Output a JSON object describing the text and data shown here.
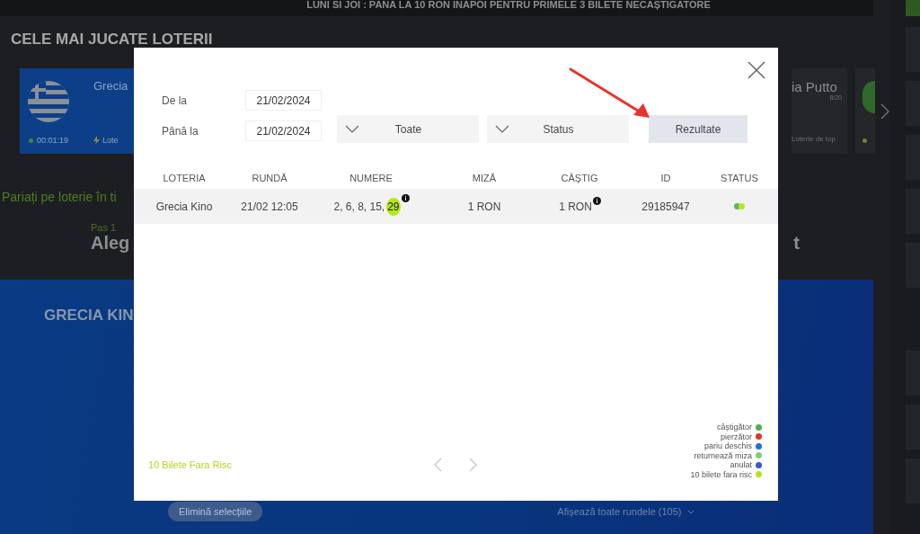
{
  "banner": {
    "text": "LUNI SI JOI : PANA LA 10 RON INAPOI PENTRU PRIMELE 3 BILETE NECAȘTIGATORE"
  },
  "section_title": "CELE MAI JUCATE LOTERII",
  "featured_card": {
    "name": "Grecia",
    "timer": "00:01:19",
    "tag": "Lote"
  },
  "side_card": {
    "name": "ia Putto",
    "count": "8/20",
    "tag": "Loterie de top"
  },
  "promo_text": "Pariați pe loterie în ti",
  "step": {
    "label": "Pas 1",
    "title": "Aleg",
    "title_end": "t"
  },
  "game_panel": {
    "title": "GRECIA KIN",
    "clear_button": "Elimină selecțiile",
    "show_all": "Afișează toate rundele (105)"
  },
  "modal": {
    "filters": {
      "from_label": "De la",
      "from_date": "21/02/2024",
      "to_label": "Până la",
      "to_date": "21/02/2024",
      "dropdowns": [
        {
          "value": "Toate"
        },
        {
          "value": "Status"
        }
      ],
      "submit": "Rezultate"
    },
    "table": {
      "columns": [
        "LOTERIA",
        "RUNDĂ",
        "NUMERE",
        "MIZĂ",
        "CÂȘTIG",
        "ID",
        "STATUS"
      ],
      "rows": [
        {
          "lottery": "Grecia Kino",
          "round": "21/02 12:05",
          "numbers": [
            {
              "text": "2, 6, 8, 15,",
              "highlighted": false
            },
            {
              "text": "29",
              "highlighted": true
            }
          ],
          "numbers_info": true,
          "stake": "1 RON",
          "win": "1 RON",
          "win_info": true,
          "id": "29185947",
          "status": [
            {
              "color": "#5cb85c"
            },
            {
              "color": "#b5e61d"
            }
          ]
        }
      ]
    },
    "footer_link": "10 Bilete Fara Risc",
    "legend": [
      {
        "label": "câștigător",
        "color": "#4caf50"
      },
      {
        "label": "pierzător",
        "color": "#d9342b"
      },
      {
        "label": "pariu deschis",
        "color": "#1e6fe0"
      },
      {
        "label": "returnează miza",
        "color": "#7fcf7f"
      },
      {
        "label": "anulat",
        "color": "#3a55d0"
      },
      {
        "label": "10 bilete fara risc",
        "color": "#b8e02a"
      }
    ]
  }
}
